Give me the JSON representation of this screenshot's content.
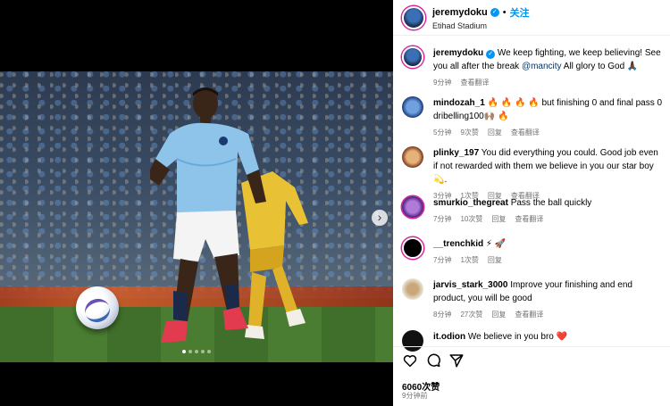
{
  "media": {
    "slide_count": 5,
    "active_slide": 1
  },
  "header": {
    "username": "jeremydoku",
    "verified_mark": "✓",
    "separator": "•",
    "follow_label": "关注",
    "location": "Etihad Stadium"
  },
  "caption": {
    "username": "jeremydoku",
    "text_before": " We keep fighting, we keep believing! See you all after the break ",
    "mention": "@mancity",
    "text_after": " All glory to God 🙏🏿",
    "time": "9分钟",
    "translate": "查看翻译"
  },
  "comments": [
    {
      "username": "mindozah_1",
      "text": " 🔥 🔥 🔥 🔥 but finishing 0 and final pass 0 dribelling100🙌🏽 🔥",
      "time": "5分钟",
      "likes": "9次赞",
      "reply": "回复",
      "translate": "查看翻译"
    },
    {
      "username": "plinky_197",
      "text": " You did everything you could. Good job even if not rewarded with them we believe in you our star boy 💫.",
      "time": "3分钟",
      "likes": "1次赞",
      "reply": "回复",
      "translate": "查看翻译"
    },
    {
      "username": "smurkio_thegreat",
      "text": " Pass the ball quickly",
      "time": "7分钟",
      "likes": "10次赞",
      "reply": "回复",
      "translate": "查看翻译"
    },
    {
      "username": "__trenchkid",
      "text": " ⚡ 🚀",
      "time": "7分钟",
      "likes": "1次赞",
      "reply": "回复",
      "translate": ""
    },
    {
      "username": "jarvis_stark_3000",
      "text": " Improve your finishing and end product, you will be good",
      "time": "8分钟",
      "likes": "27次赞",
      "reply": "回复",
      "translate": "查看翻译"
    },
    {
      "username": "it.odion",
      "text": " We believe in you bro ❤️",
      "time": "",
      "likes": "",
      "reply": "",
      "translate": ""
    }
  ],
  "footer": {
    "likes": "6060次赞",
    "time_ago": "9分钟前"
  },
  "colors": {
    "accent": "#0095f6",
    "story_ring": "#d6249f"
  }
}
